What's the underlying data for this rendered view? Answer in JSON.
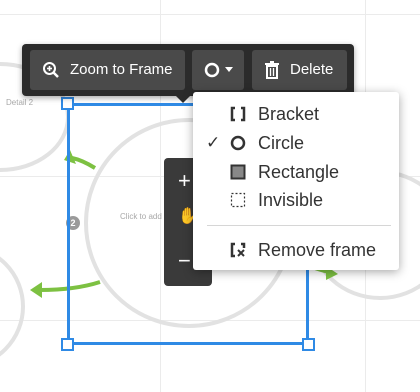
{
  "toolbar": {
    "zoom_to_frame_label": "Zoom to Frame",
    "shape_menu_icon": "circle-icon",
    "delete_label": "Delete"
  },
  "shape_menu": {
    "items": [
      {
        "label": "Bracket",
        "icon": "bracket-icon",
        "checked": false
      },
      {
        "label": "Circle",
        "icon": "circle-icon",
        "checked": true
      },
      {
        "label": "Rectangle",
        "icon": "rectangle-icon",
        "checked": false
      },
      {
        "label": "Invisible",
        "icon": "dashed-square-icon",
        "checked": false
      }
    ],
    "remove_label": "Remove frame",
    "check_glyph": "✓"
  },
  "canvas": {
    "step_badge": "2",
    "node_text": "Click to add",
    "left_node_text": "Detail 2"
  },
  "zoom_controls": {
    "zoom_in": "+",
    "zoom_out": "−"
  },
  "colors": {
    "frame_blue": "#2f8ae5",
    "arrow_green": "#7dc142",
    "toolbar_bg": "#2b2b2b",
    "button_bg": "#4a4a4a"
  }
}
